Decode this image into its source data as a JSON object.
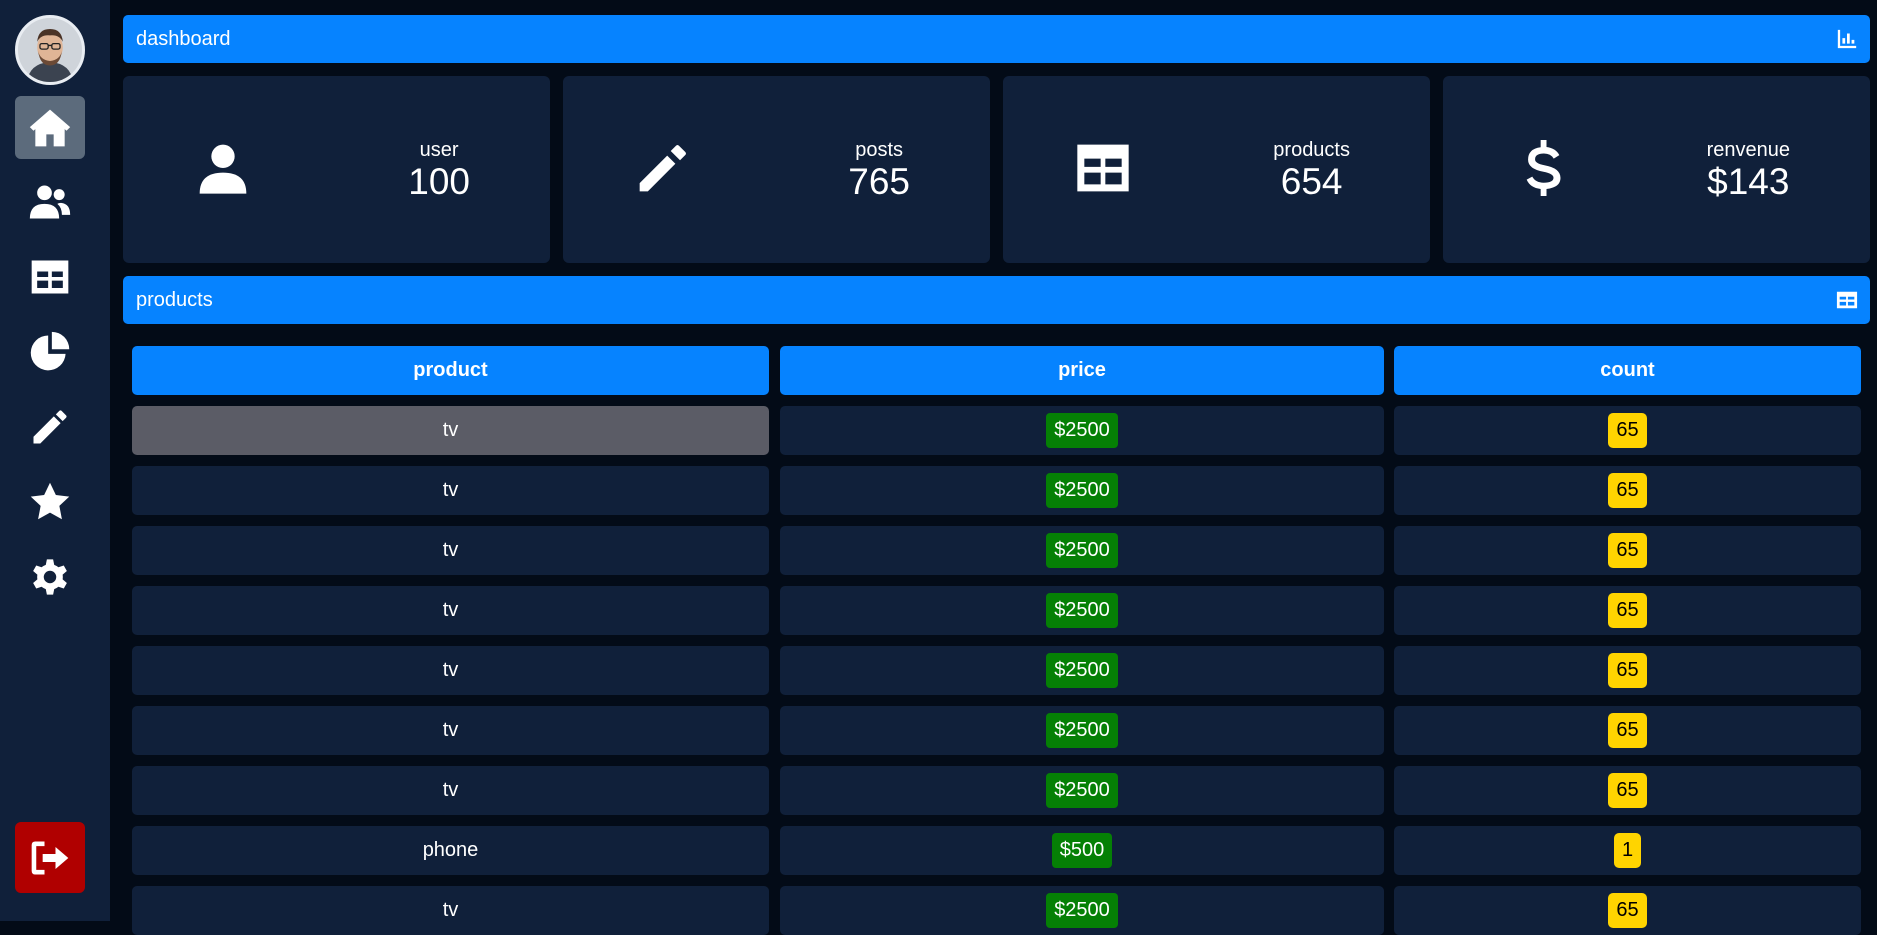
{
  "sidebar": {
    "avatar": "user-avatar",
    "items": [
      {
        "icon": "home-icon",
        "active": true
      },
      {
        "icon": "users-icon",
        "active": false
      },
      {
        "icon": "table-icon",
        "active": false
      },
      {
        "icon": "pie-chart-icon",
        "active": false
      },
      {
        "icon": "pencil-icon",
        "active": false
      },
      {
        "icon": "star-icon",
        "active": false
      },
      {
        "icon": "gear-icon",
        "active": false
      }
    ],
    "logout_icon": "logout-icon"
  },
  "dashboard": {
    "title": "dashboard",
    "icon": "bar-chart-icon"
  },
  "cards": [
    {
      "label": "user",
      "value": "100",
      "icon": "user-icon"
    },
    {
      "label": "posts",
      "value": "765",
      "icon": "pencil-icon"
    },
    {
      "label": "products",
      "value": "654",
      "icon": "table-icon"
    },
    {
      "label": "renvenue",
      "value": "$143",
      "icon": "dollar-icon"
    }
  ],
  "products": {
    "title": "products",
    "icon": "table-icon",
    "headers": {
      "product": "product",
      "price": "price",
      "count": "count"
    },
    "rows": [
      {
        "product": "tv",
        "price": "$2500",
        "count": "65",
        "selected": true
      },
      {
        "product": "tv",
        "price": "$2500",
        "count": "65"
      },
      {
        "product": "tv",
        "price": "$2500",
        "count": "65"
      },
      {
        "product": "tv",
        "price": "$2500",
        "count": "65"
      },
      {
        "product": "tv",
        "price": "$2500",
        "count": "65"
      },
      {
        "product": "tv",
        "price": "$2500",
        "count": "65"
      },
      {
        "product": "tv",
        "price": "$2500",
        "count": "65"
      },
      {
        "product": "phone",
        "price": "$500",
        "count": "1"
      },
      {
        "product": "tv",
        "price": "$2500",
        "count": "65"
      }
    ]
  },
  "colors": {
    "accent": "#0683ff",
    "panel": "#10203a",
    "background": "#030b17",
    "price_badge": "#058005",
    "count_badge": "#ffd400",
    "logout": "#b00000",
    "active_nav": "#5c6b7c"
  }
}
